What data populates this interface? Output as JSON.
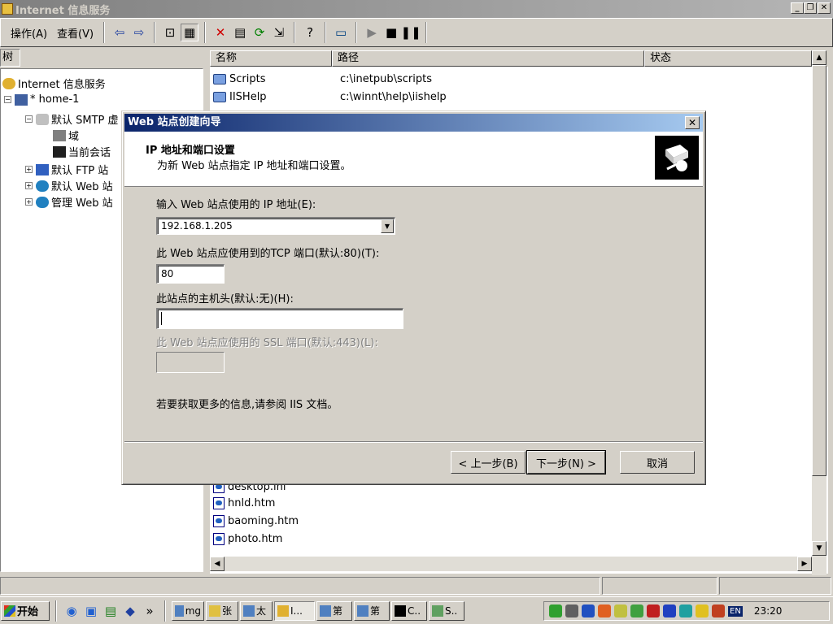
{
  "window": {
    "title": "Internet 信息服务"
  },
  "menu": {
    "action": "操作(A)",
    "view": "查看(V)"
  },
  "toolbar_icons": [
    "back-icon",
    "forward-icon",
    "up-icon",
    "show-tree-icon",
    "delete-icon",
    "properties-icon",
    "refresh-icon",
    "export-icon",
    "help-icon",
    "computer-icon",
    "play-icon",
    "stop-icon",
    "pause-icon"
  ],
  "tree": {
    "header": "树",
    "items": [
      {
        "label": "Internet 信息服务"
      },
      {
        "label": "* home-1"
      },
      {
        "label": "默认 SMTP 虚"
      },
      {
        "label": "域"
      },
      {
        "label": "当前会话"
      },
      {
        "label": "默认 FTP 站"
      },
      {
        "label": "默认 Web 站"
      },
      {
        "label": "管理 Web 站"
      }
    ]
  },
  "list": {
    "columns": [
      "名称",
      "路径",
      "状态"
    ],
    "rows": [
      {
        "name": "Scripts",
        "path": "c:\\inetpub\\scripts"
      },
      {
        "name": "IISHelp",
        "path": "c:\\winnt\\help\\iishelp"
      }
    ],
    "files": [
      "desktop.ini",
      "hnld.htm",
      "baoming.htm",
      "photo.htm"
    ]
  },
  "dialog": {
    "title": "Web 站点创建向导",
    "header_title": "IP 地址和端口设置",
    "header_subtitle": "为新 Web 站点指定 IP 地址和端口设置。",
    "ip_label": "输入 Web 站点使用的 IP 地址(E):",
    "ip_value": "192.168.1.205",
    "port_label": "此 Web 站点应使用到的TCP 端口(默认:80)(T):",
    "port_value": "80",
    "host_label": "此站点的主机头(默认:无)(H):",
    "host_value": "",
    "ssl_label": "此 Web 站点应使用的 SSL 端口(默认:443)(L):",
    "ssl_value": "",
    "info_text": "若要获取更多的信息,请参阅 IIS 文档。",
    "back_button": "< 上一步(B)",
    "next_button": "下一步(N) >",
    "cancel_button": "取消"
  },
  "taskbar": {
    "start": "开始",
    "buttons": [
      "mg",
      "张",
      "太",
      "I...",
      "第",
      "第",
      "C..",
      "S.."
    ],
    "clock": "23:20",
    "lang": "EN"
  }
}
